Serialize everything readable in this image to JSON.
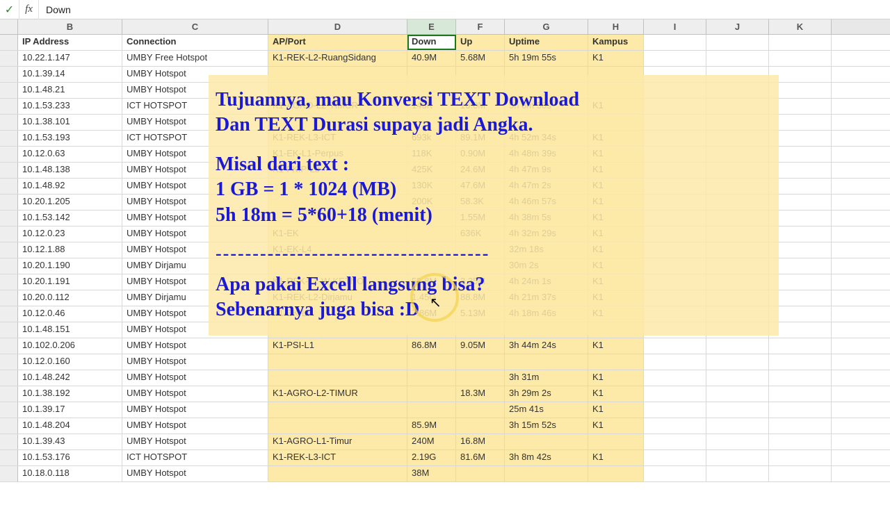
{
  "formula_bar": {
    "confirm_icon": "✓",
    "fx_label": "fx",
    "value": "Down"
  },
  "columns": [
    "B",
    "C",
    "D",
    "E",
    "F",
    "G",
    "H",
    "I",
    "J",
    "K"
  ],
  "headers": {
    "b": "IP Address",
    "c": "Connection",
    "d": "AP/Port",
    "e": "Down",
    "f": "Up",
    "g": "Uptime",
    "h": "Kampus"
  },
  "rows": [
    {
      "b": "10.22.1.147",
      "c": "UMBY Free Hotspot",
      "d": "K1-REK-L2-RuangSidang",
      "e": "40.9M",
      "f": "5.68M",
      "g": "5h 19m 55s",
      "h": "K1"
    },
    {
      "b": "10.1.39.14",
      "c": "UMBY Hotspot",
      "d": "",
      "e": "",
      "f": "",
      "g": "",
      "h": ""
    },
    {
      "b": "10.1.48.21",
      "c": "UMBY Hotspot",
      "d": "",
      "e": "",
      "f": "",
      "g": "",
      "h": ""
    },
    {
      "b": "10.1.53.233",
      "c": "ICT HOTSPOT",
      "d": "K1-AGRO-L2-TIMUR",
      "e": "143K",
      "f": "16.0M",
      "g": "5h 8m 50s",
      "h": "K1"
    },
    {
      "b": "10.1.38.101",
      "c": "UMBY Hotspot",
      "d": "",
      "e": "",
      "f": "",
      "g": "",
      "h": ""
    },
    {
      "b": "10.1.53.193",
      "c": "ICT HOTSPOT",
      "d": "K1-REK-L3-ICT",
      "e": "693k",
      "f": "89.1M",
      "g": "4h 52m 34s",
      "h": "K1"
    },
    {
      "b": "10.12.0.63",
      "c": "UMBY Hotspot",
      "d": "K1-EK-L1-Perpus",
      "e": "118K",
      "f": "0.90M",
      "g": "4h 48m 39s",
      "h": "K1"
    },
    {
      "b": "10.1.48.138",
      "c": "UMBY Hotspot",
      "d": "K1-FKIP-L3",
      "e": "425K",
      "f": "24.6M",
      "g": "4h 47m 9s",
      "h": "K1"
    },
    {
      "b": "10.1.48.92",
      "c": "UMBY Hotspot",
      "d": "",
      "e": "130K",
      "f": "47.6M",
      "g": "4h 47m 2s",
      "h": "K1"
    },
    {
      "b": "10.20.1.205",
      "c": "UMBY Hotspot",
      "d": "",
      "e": "200K",
      "f": "58.3K",
      "g": "4h 46m 57s",
      "h": "K1"
    },
    {
      "b": "10.1.53.142",
      "c": "UMBY Hotspot",
      "d": "",
      "e": "",
      "f": "1.55M",
      "g": "4h 38m 5s",
      "h": "K1"
    },
    {
      "b": "10.12.0.23",
      "c": "UMBY Hotspot",
      "d": "K1-EK",
      "e": "",
      "f": "636K",
      "g": "4h 32m 29s",
      "h": "K1"
    },
    {
      "b": "10.12.1.88",
      "c": "UMBY Hotspot",
      "d": "K1-EK-L4",
      "e": "",
      "f": "",
      "g": "32m 18s",
      "h": "K1"
    },
    {
      "b": "10.20.1.190",
      "c": "UMBY Dirjamu",
      "d": "",
      "e": "",
      "f": "",
      "g": "30m 2s",
      "h": "K1"
    },
    {
      "b": "10.20.1.191",
      "c": "UMBY Hotspot",
      "d": "K1-REK-L1-W-KETNO",
      "e": "55.8M",
      "f": "3.35M",
      "g": "4h 24m 1s",
      "h": "K1"
    },
    {
      "b": "10.20.0.112",
      "c": "UMBY Dirjamu",
      "d": "K1-REK-L2-Dirjamu",
      "e": "1.45G",
      "f": "88.8M",
      "g": "4h 21m 37s",
      "h": "K1"
    },
    {
      "b": "10.12.0.46",
      "c": "UMBY Hotspot",
      "d": "K1-EK-L3",
      "e": "7.86M",
      "f": "5.13M",
      "g": "4h 18m 46s",
      "h": "K1"
    },
    {
      "b": "10.1.48.151",
      "c": "UMBY Hotspot",
      "d": "",
      "e": "",
      "f": "",
      "g": "",
      "h": ""
    },
    {
      "b": "10.102.0.206",
      "c": "UMBY Hotspot",
      "d": "K1-PSI-L1",
      "e": "86.8M",
      "f": "9.05M",
      "g": "3h 44m 24s",
      "h": "K1"
    },
    {
      "b": "10.12.0.160",
      "c": "UMBY Hotspot",
      "d": "",
      "e": "",
      "f": "",
      "g": "",
      "h": ""
    },
    {
      "b": "10.1.48.242",
      "c": "UMBY Hotspot",
      "d": "",
      "e": "",
      "f": "",
      "g": "3h 31m",
      "h": "K1"
    },
    {
      "b": "10.1.38.192",
      "c": "UMBY Hotspot",
      "d": "K1-AGRO-L2-TIMUR",
      "e": "",
      "f": "18.3M",
      "g": "3h 29m 2s",
      "h": "K1"
    },
    {
      "b": "10.1.39.17",
      "c": "UMBY Hotspot",
      "d": "",
      "e": "",
      "f": "",
      "g": "25m 41s",
      "h": "K1"
    },
    {
      "b": "10.1.48.204",
      "c": "UMBY Hotspot",
      "d": "",
      "e": "85.9M",
      "f": "",
      "g": "3h 15m 52s",
      "h": "K1"
    },
    {
      "b": "10.1.39.43",
      "c": "UMBY Hotspot",
      "d": "K1-AGRO-L1-Timur",
      "e": "240M",
      "f": "16.8M",
      "g": "",
      "h": ""
    },
    {
      "b": "10.1.53.176",
      "c": "ICT HOTSPOT",
      "d": "K1-REK-L3-ICT",
      "e": "2.19G",
      "f": "81.6M",
      "g": "3h 8m 42s",
      "h": "K1"
    },
    {
      "b": "10.18.0.118",
      "c": "UMBY Hotspot",
      "d": "",
      "e": "38M",
      "f": "",
      "g": "",
      "h": ""
    }
  ],
  "overlay": {
    "line1": "Tujuannya, mau Konversi TEXT Download",
    "line2": "Dan TEXT Durasi supaya jadi Angka.",
    "line3": "Misal dari text :",
    "line4": "1 GB = 1 * 1024 (MB)",
    "line5": "5h 18m = 5*60+18 (menit)",
    "dashes": "-------------------------------------",
    "line6": "Apa pakai Excell langsung bisa?",
    "line7": "Sebenarnya juga bisa :D"
  }
}
